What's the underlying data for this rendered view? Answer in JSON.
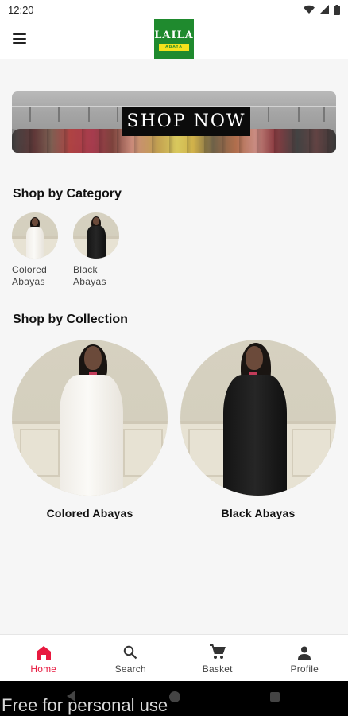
{
  "status_bar": {
    "time": "12:20"
  },
  "header": {
    "logo_text": "LAILA",
    "logo_subtext": "ABAYA"
  },
  "banner": {
    "cta_label": "SHOP NOW"
  },
  "categories": {
    "title": "Shop by Category",
    "items": [
      {
        "label_line1": "Colored",
        "label_line2": "Abayas",
        "robe": "white"
      },
      {
        "label_line1": "Black",
        "label_line2": "Abayas",
        "robe": "black"
      }
    ]
  },
  "collections": {
    "title": "Shop by Collection",
    "items": [
      {
        "label": "Colored Abayas",
        "robe": "white"
      },
      {
        "label": "Black Abayas",
        "robe": "black"
      }
    ]
  },
  "bottom_nav": {
    "items": [
      {
        "label": "Home",
        "icon": "home-icon",
        "active": true
      },
      {
        "label": "Search",
        "icon": "search-icon",
        "active": false
      },
      {
        "label": "Basket",
        "icon": "cart-icon",
        "active": false
      },
      {
        "label": "Profile",
        "icon": "profile-icon",
        "active": false
      }
    ]
  },
  "watermark": "Free for personal use",
  "colors": {
    "accent": "#e8193f",
    "logo_green": "#1f8a2e",
    "logo_yellow": "#f3e21c"
  }
}
